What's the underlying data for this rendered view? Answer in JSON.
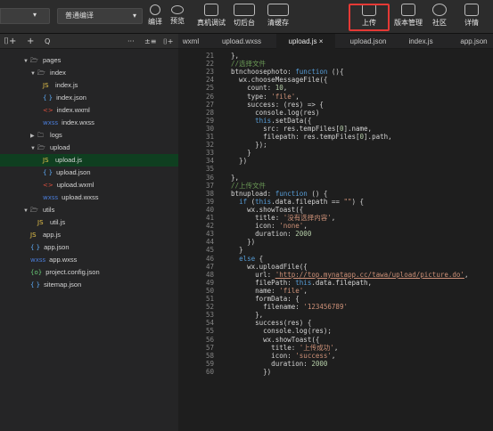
{
  "toolbar": {
    "mode_select": "普通编译",
    "buttons": [
      {
        "label": "编译"
      },
      {
        "label": "预览"
      },
      {
        "label": "真机调试"
      },
      {
        "label": "切后台"
      },
      {
        "label": "清缓存"
      },
      {
        "label": "上传"
      },
      {
        "label": "版本管理"
      },
      {
        "label": "社区"
      },
      {
        "label": "详情"
      }
    ],
    "highlight_color": "#e53935"
  },
  "sidebar_head": {
    "add": "+",
    "search": "Q",
    "more": "···",
    "collapse": "±≡",
    "split": "⌷+"
  },
  "tabs": [
    {
      "label": "wxml"
    },
    {
      "label": "upload.wxss"
    },
    {
      "label": "upload.js",
      "close": "×"
    },
    {
      "label": "upload.json"
    },
    {
      "label": "index.js"
    },
    {
      "label": "app.json"
    }
  ],
  "tree": [
    {
      "label": "pages",
      "icon": "folder"
    },
    {
      "label": "index",
      "icon": "folder"
    },
    {
      "label": "index.js",
      "icon": "JS"
    },
    {
      "label": "index.json",
      "icon": "{ }"
    },
    {
      "label": "index.wxml",
      "icon": "<>"
    },
    {
      "label": "index.wxss",
      "icon": "wxss"
    },
    {
      "label": "logs",
      "icon": "folder"
    },
    {
      "label": "upload",
      "icon": "folder"
    },
    {
      "label": "upload.js",
      "icon": "JS"
    },
    {
      "label": "upload.json",
      "icon": "{ }"
    },
    {
      "label": "upload.wxml",
      "icon": "<>"
    },
    {
      "label": "upload.wxss",
      "icon": "wxss"
    },
    {
      "label": "utils",
      "icon": "folder"
    },
    {
      "label": "util.js",
      "icon": "JS"
    },
    {
      "label": "app.js",
      "icon": "JS"
    },
    {
      "label": "app.json",
      "icon": "{ }"
    },
    {
      "label": "app.wxss",
      "icon": "wxss"
    },
    {
      "label": "project.config.json",
      "icon": "{o}"
    },
    {
      "label": "sitemap.json",
      "icon": "{ }"
    }
  ],
  "code": {
    "line_numbers": [
      "21",
      "22",
      "23",
      "24",
      "25",
      "26",
      "27",
      "28",
      "29",
      "30",
      "31",
      "32",
      "33",
      "34",
      "35",
      "36",
      "37",
      "38",
      "39",
      "40",
      "41",
      "42",
      "43",
      "44",
      "45",
      "46",
      "47",
      "48",
      "49",
      "50",
      "51",
      "52",
      "53",
      "54",
      "55",
      "56",
      "57",
      "58",
      "59",
      "60"
    ],
    "lines": [
      "  },",
      "  //选择文件",
      "  btnchoosephoto: function (){",
      "    wx.chooseMessageFile({",
      "      count: 10,",
      "      type: 'file',",
      "      success: (res) => {",
      "        console.log(res)",
      "        this.setData({",
      "          src: res.tempFiles[0].name,",
      "          filepath: res.tempFiles[0].path,",
      "        });",
      "      }",
      "    })",
      "",
      "  },",
      "  //上传文件",
      "  btnupload: function () {",
      "    if (this.data.filepath == \"\") {",
      "      wx.showToast({",
      "        title: '没有选择内容',",
      "        icon: 'none',",
      "        duration: 2000",
      "      })",
      "    }",
      "    else {",
      "      wx.uploadFile({",
      "        url: 'http://top.mynatapp.cc/tawa/upload/picture.do',",
      "        filePath: this.data.filepath,",
      "        name: 'file',",
      "        formData: {",
      "          filename: '123456789'",
      "        },",
      "        success(res) {",
      "          console.log(res);",
      "          wx.showToast({",
      "            title: '上传成功',",
      "            icon: 'success',",
      "            duration: 2000",
      "          })"
    ]
  }
}
